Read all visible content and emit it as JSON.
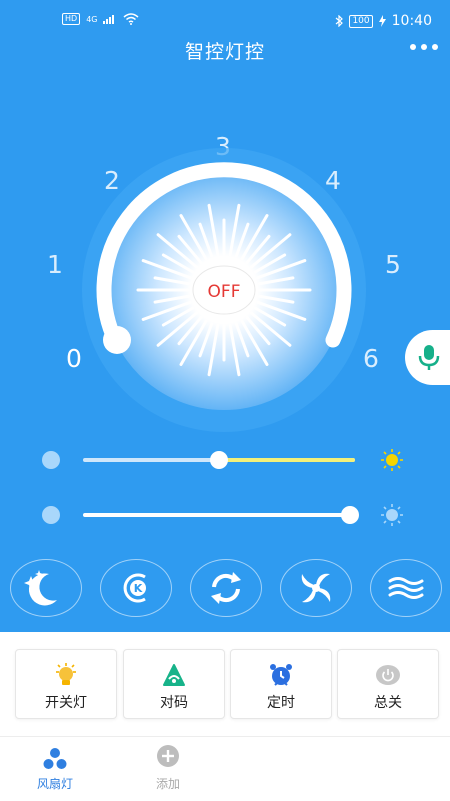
{
  "status_bar": {
    "hd": "HD",
    "signal": "4G",
    "battery": "100",
    "time": "10:40"
  },
  "header": {
    "title": "智控灯控"
  },
  "dial": {
    "state_label": "OFF",
    "numbers": [
      "0",
      "1",
      "2",
      "3",
      "4",
      "5",
      "6"
    ],
    "level": 0
  },
  "sliders": {
    "brightness": 0.5,
    "color_temp": 1.0
  },
  "modes": [
    "moon-stars-icon",
    "k-button-icon",
    "refresh-icon",
    "fan-swirl-icon",
    "wind-waves-icon"
  ],
  "cards": [
    {
      "label": "开关灯",
      "icon": "bulb-icon"
    },
    {
      "label": "对码",
      "icon": "pairing-icon"
    },
    {
      "label": "定时",
      "icon": "alarm-clock-icon"
    },
    {
      "label": "总关",
      "icon": "power-icon"
    }
  ],
  "tabs": [
    {
      "label": "风扇灯",
      "icon": "fan-icon",
      "active": true
    },
    {
      "label": "添加",
      "icon": "add-icon",
      "active": false
    }
  ],
  "colors": {
    "primary": "#2f9bf0",
    "active_tab": "#2f7fe0",
    "off_text": "#e53935",
    "slider_fill": "#f3f07a"
  }
}
